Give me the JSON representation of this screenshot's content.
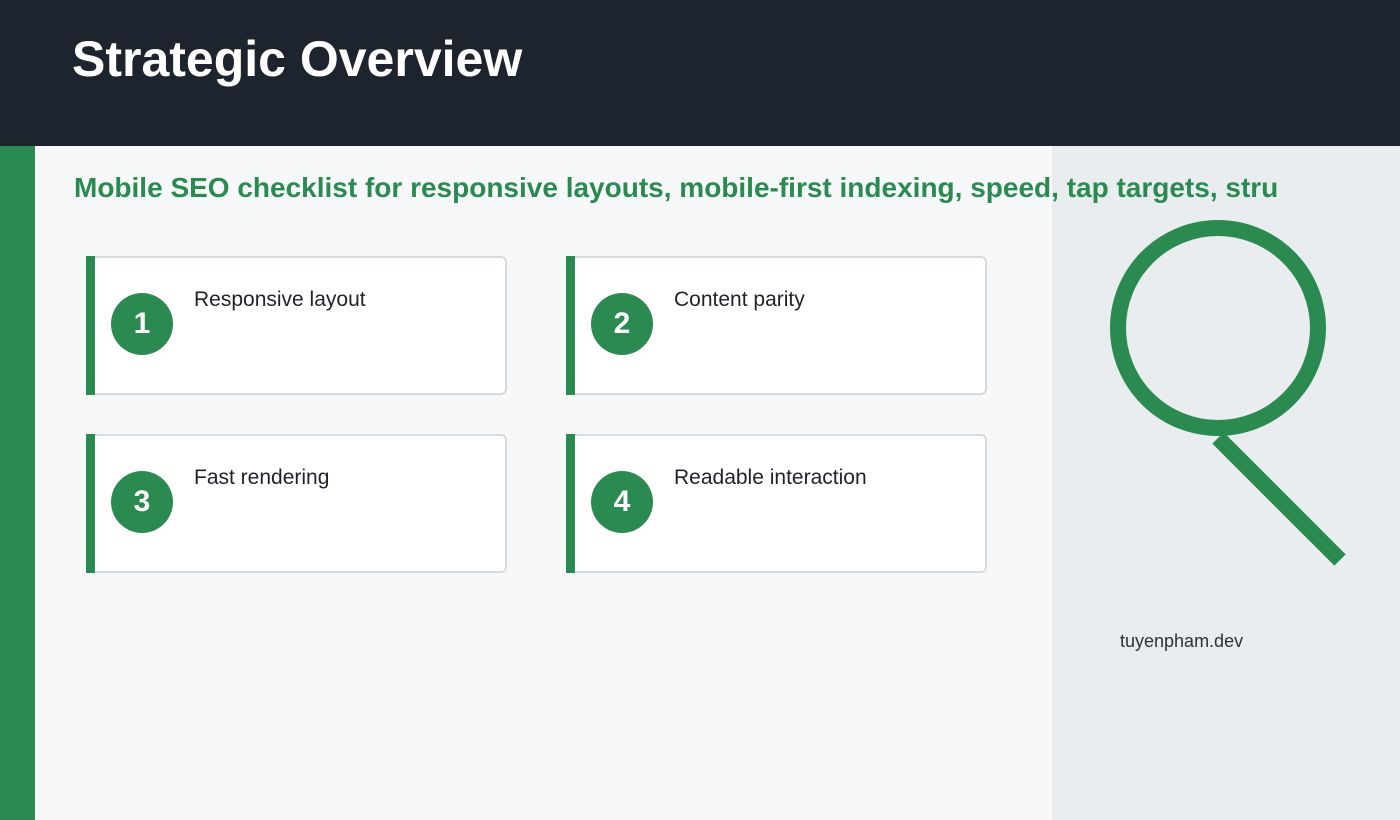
{
  "header": {
    "title": "Strategic Overview"
  },
  "subtitle": "Mobile SEO checklist for responsive layouts, mobile-first indexing, speed, tap targets, stru",
  "cards": [
    {
      "number": "1",
      "label": "Responsive layout"
    },
    {
      "number": "2",
      "label": "Content parity"
    },
    {
      "number": "3",
      "label": "Fast rendering"
    },
    {
      "number": "4",
      "label": "Readable interaction"
    }
  ],
  "side_panel": {
    "icon": "magnifier-icon",
    "site": "tuyenpham.dev"
  },
  "colors": {
    "header_bg": "#1e242d",
    "accent": "#2a8a50",
    "page_bg": "#f6f8fa",
    "side_bg": "#e9edf0",
    "card_bg": "#ffffff",
    "card_border": "#d6dbe1"
  }
}
